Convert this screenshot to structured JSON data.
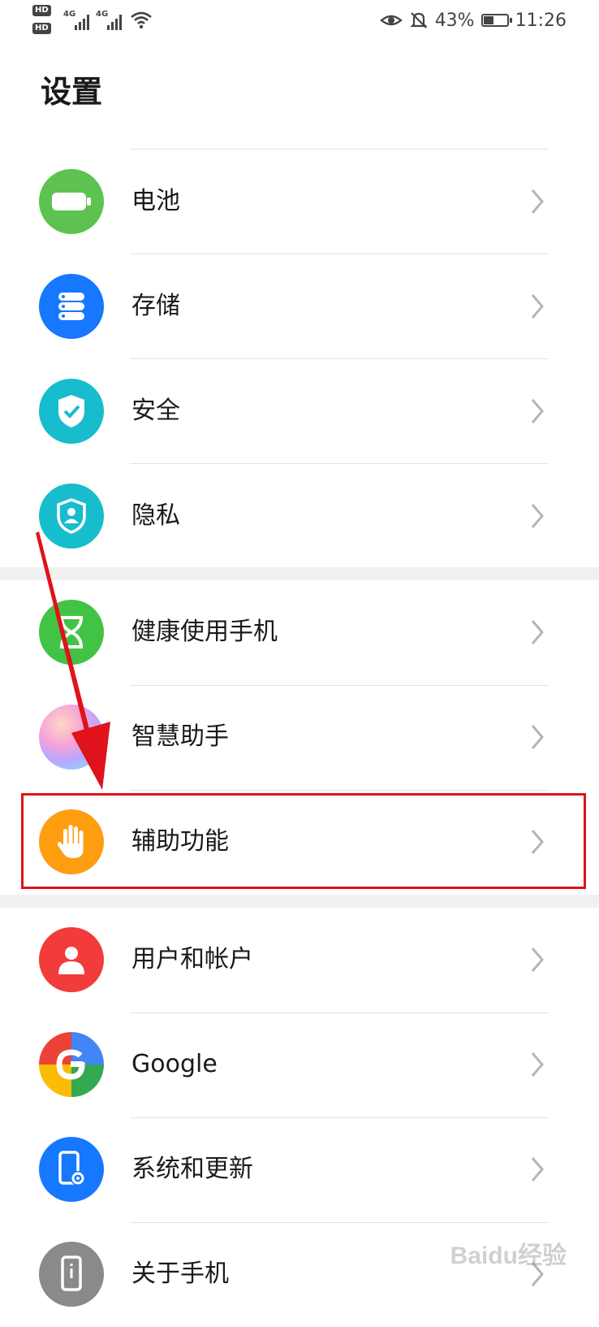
{
  "status_bar": {
    "hd1": "HD",
    "hd2": "HD",
    "net1": "4G",
    "net2": "4G",
    "battery_percent": "43%",
    "battery_level": 0.43,
    "time": "11:26",
    "icons": [
      "eye-comfort-icon",
      "bell-off-icon",
      "battery-icon",
      "wifi-icon",
      "signal-icon"
    ]
  },
  "page": {
    "title": "设置"
  },
  "items": [
    {
      "label": "电池",
      "icon": "battery-icon",
      "color": "#5dc24f"
    },
    {
      "label": "存储",
      "icon": "storage-icon",
      "color": "#1677ff"
    },
    {
      "label": "安全",
      "icon": "shield-check-icon",
      "color": "#17bccd"
    },
    {
      "label": "隐私",
      "icon": "privacy-icon",
      "color": "#17bccd"
    },
    {
      "label": "健康使用手机",
      "icon": "hourglass-icon",
      "color": "#42c345"
    },
    {
      "label": "智慧助手",
      "icon": "smart-assistant-icon",
      "color": "#d0a0ff"
    },
    {
      "label": "辅助功能",
      "icon": "hand-icon",
      "color": "#ff9d10"
    },
    {
      "label": "用户和帐户",
      "icon": "user-icon",
      "color": "#f23b3b"
    },
    {
      "label": "Google",
      "icon": "google-icon",
      "color": "#4285f4"
    },
    {
      "label": "系统和更新",
      "icon": "phone-settings-icon",
      "color": "#1677ff"
    },
    {
      "label": "关于手机",
      "icon": "phone-info-icon",
      "color": "#8a8a8a"
    }
  ],
  "annotation": {
    "color": "#e0121a"
  },
  "watermark": "Baidu经验"
}
